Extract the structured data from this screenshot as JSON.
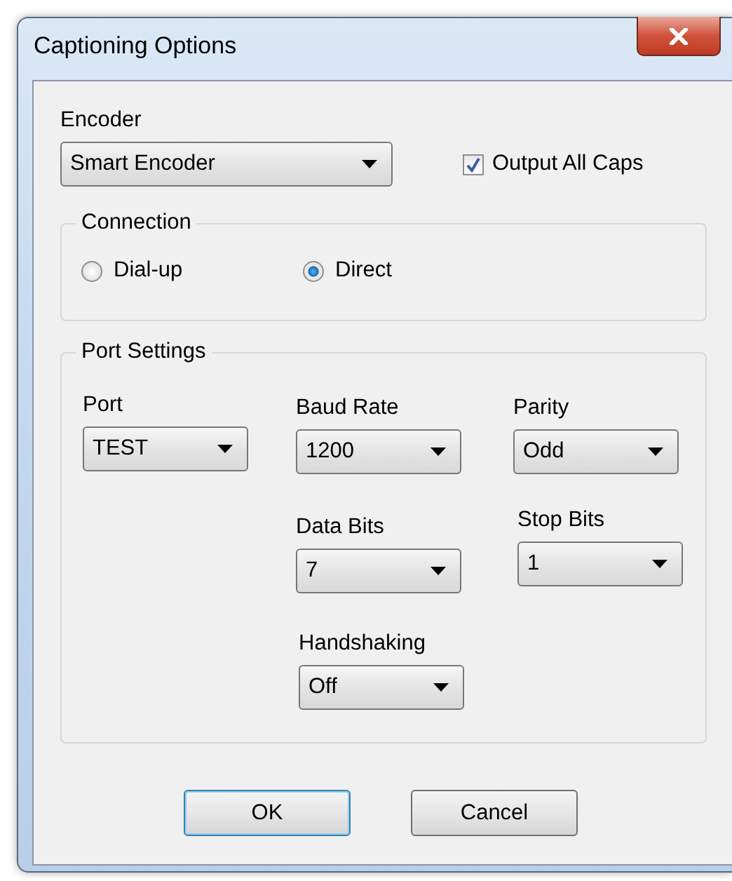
{
  "window": {
    "title": "Captioning Options"
  },
  "encoder": {
    "label": "Encoder",
    "value": "Smart Encoder"
  },
  "output_all_caps": {
    "label": "Output All Caps",
    "checked": true
  },
  "connection": {
    "legend": "Connection",
    "options": [
      {
        "label": "Dial-up",
        "selected": false
      },
      {
        "label": "Direct",
        "selected": true
      }
    ]
  },
  "port_settings": {
    "legend": "Port Settings",
    "fields": [
      {
        "label": "Port",
        "value": "TEST"
      },
      {
        "label": "Baud Rate",
        "value": "1200"
      },
      {
        "label": "Parity",
        "value": "Odd"
      },
      {
        "label": "Data Bits",
        "value": "7"
      },
      {
        "label": "Stop Bits",
        "value": "1"
      },
      {
        "label": "Handshaking",
        "value": "Off"
      }
    ]
  },
  "buttons": [
    {
      "label": "OK",
      "default": true
    },
    {
      "label": "Cancel",
      "default": false
    }
  ]
}
